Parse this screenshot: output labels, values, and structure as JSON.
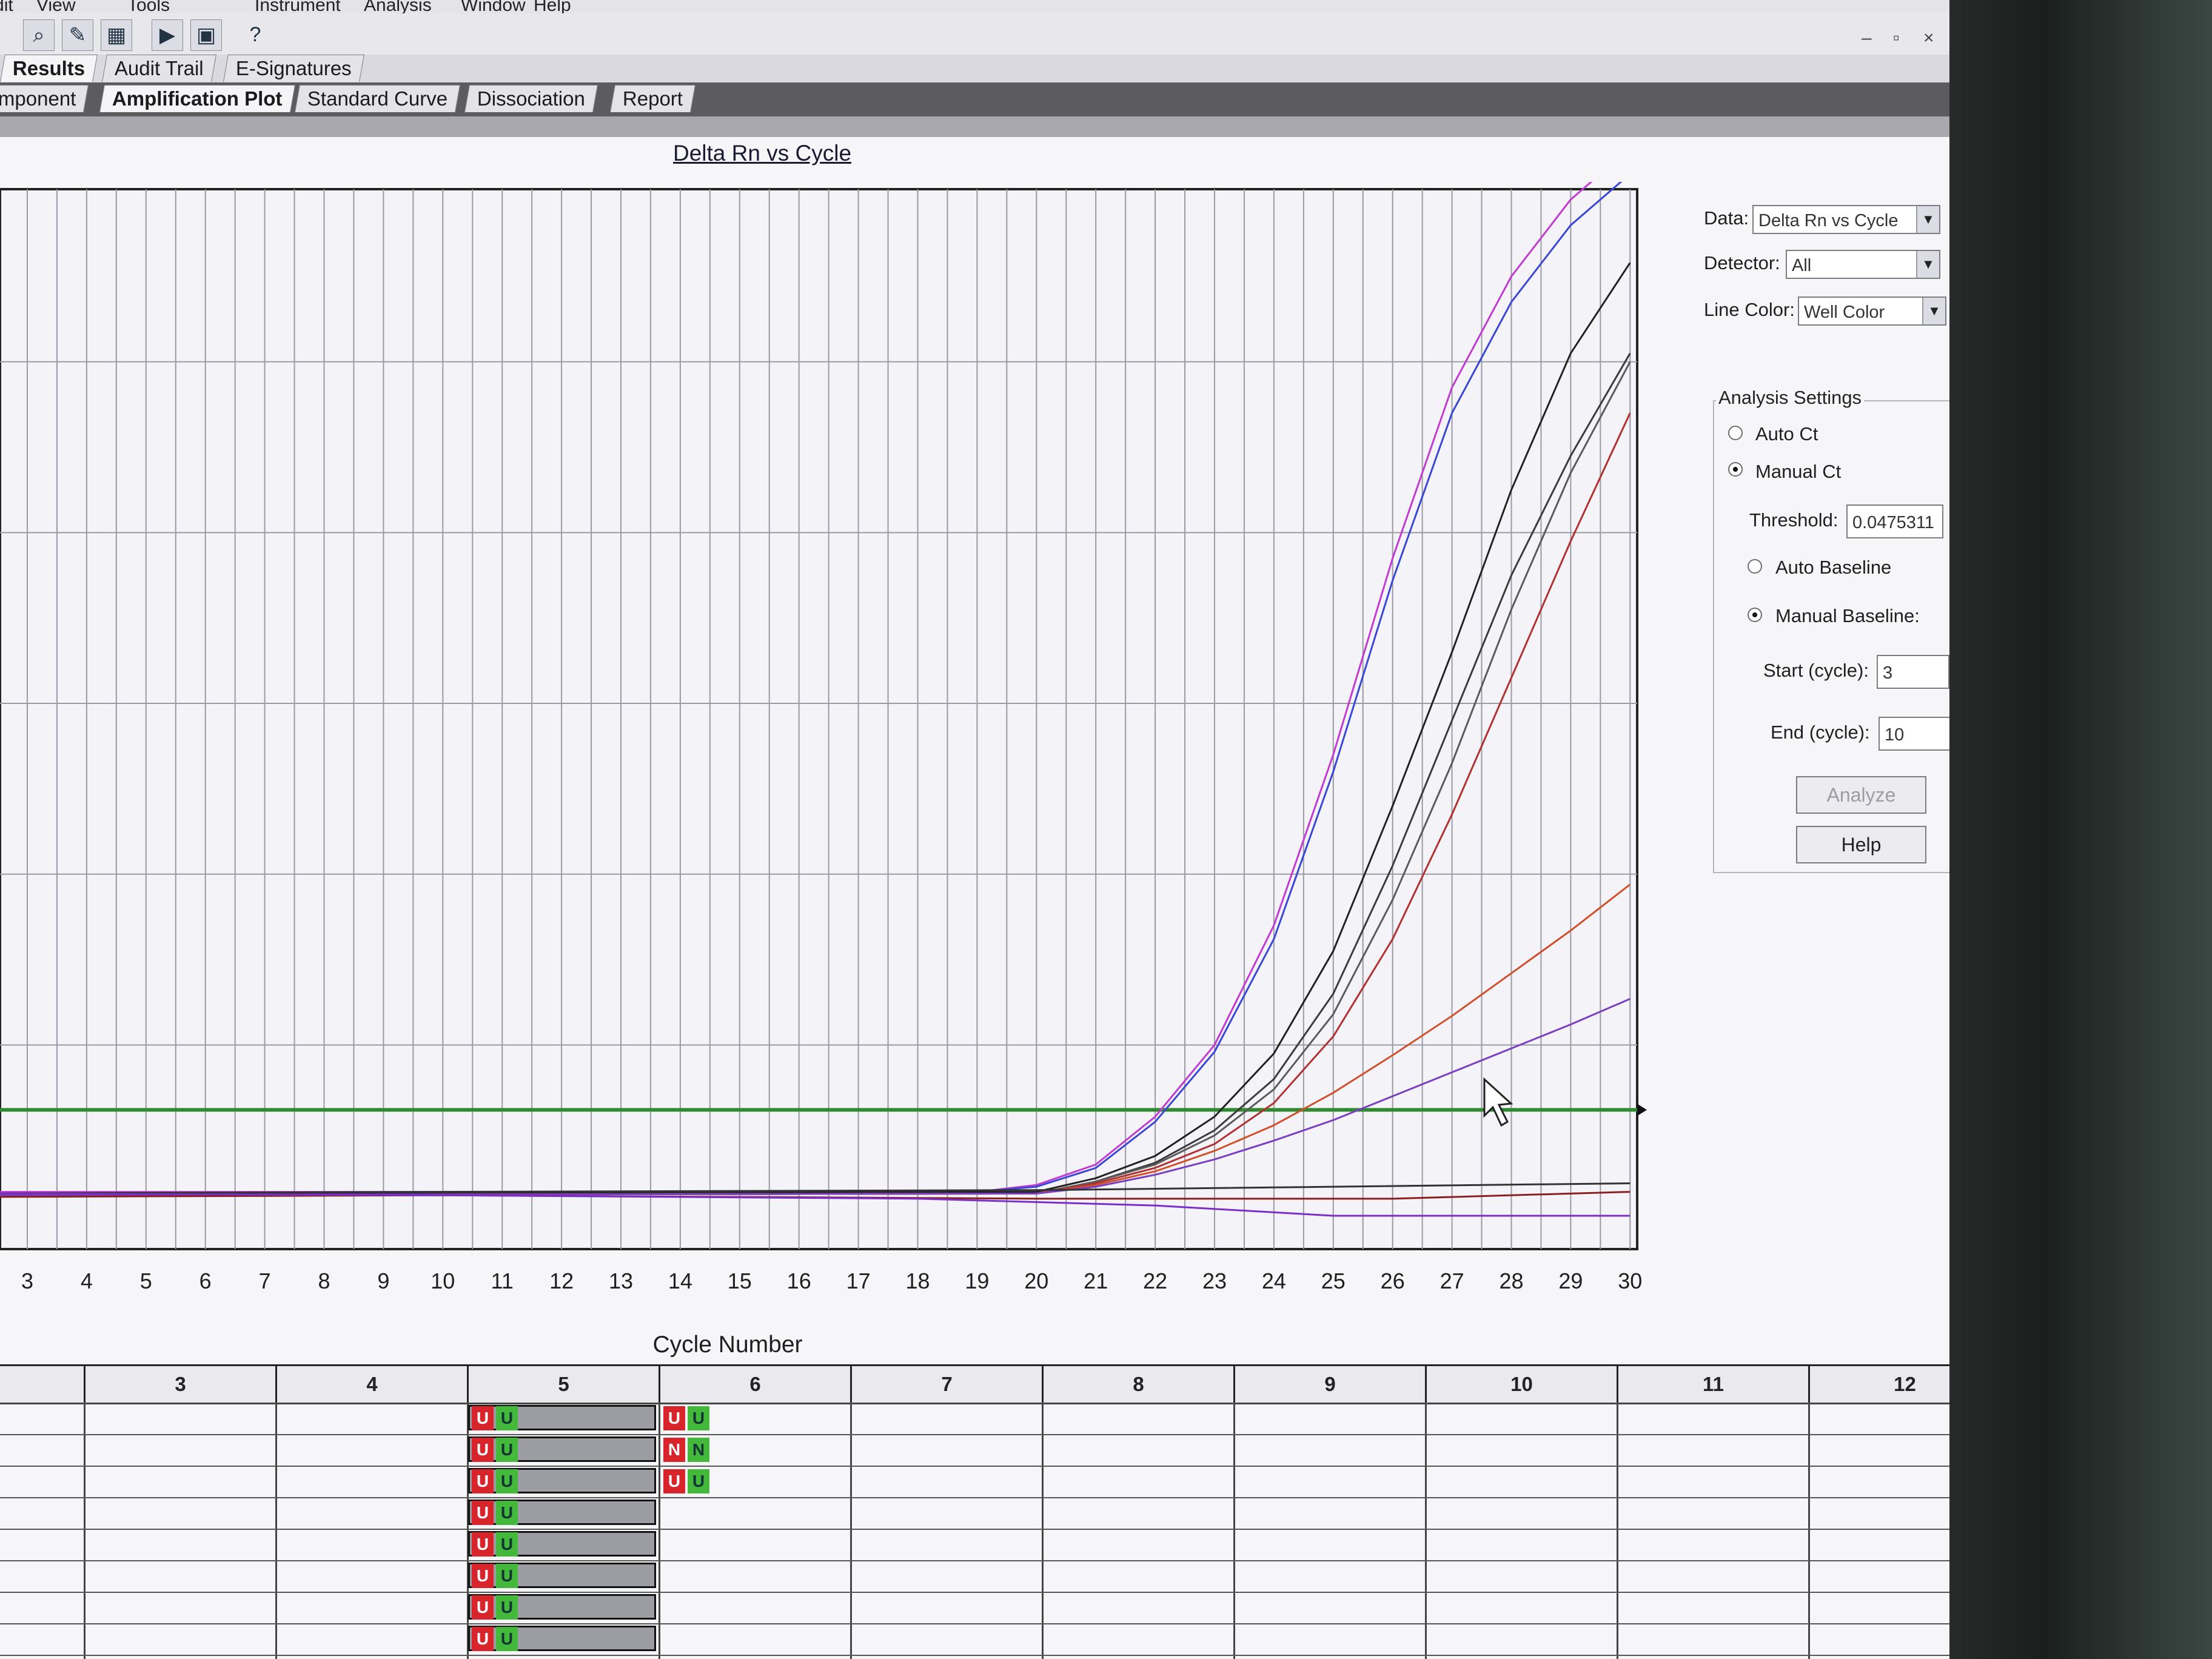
{
  "menu": [
    "Edit",
    "View",
    "Tools",
    "Instrument",
    "Analysis",
    "Window",
    "Help"
  ],
  "window_controls": {
    "minimize": "–",
    "restore": "▫",
    "close": "×"
  },
  "results_tabs": [
    "Results",
    "Audit Trail",
    "E-Signatures"
  ],
  "view_tabs": [
    "mponent",
    "Amplification Plot",
    "Standard Curve",
    "Dissociation",
    "Report"
  ],
  "active_view_tab": "Amplification Plot",
  "chart_data": {
    "type": "line",
    "title": "Delta Rn vs Cycle",
    "xlabel": "Cycle Number",
    "ylabel": "",
    "x_ticks": [
      3,
      4,
      5,
      6,
      7,
      8,
      9,
      10,
      11,
      12,
      13,
      14,
      15,
      16,
      17,
      18,
      19,
      20,
      21,
      22,
      23,
      24,
      25,
      26,
      27,
      28,
      29,
      30
    ],
    "xlim": [
      2.5,
      30.5
    ],
    "ylim": [
      0,
      6
    ],
    "grid": true,
    "threshold": {
      "value": 0.62,
      "color": "#2f8a2f"
    },
    "series": [
      {
        "color": "#c23bd1",
        "x": [
          2,
          19,
          20,
          21,
          22,
          23,
          24,
          25,
          26,
          27,
          28,
          29,
          30
        ],
        "values": [
          0.14,
          0.14,
          0.18,
          0.3,
          0.58,
          1.0,
          1.7,
          2.7,
          3.85,
          4.85,
          5.5,
          5.95,
          6.25
        ]
      },
      {
        "color": "#3a46d6",
        "x": [
          2,
          19,
          20,
          21,
          22,
          23,
          24,
          25,
          26,
          27,
          28,
          29,
          30
        ],
        "values": [
          0.13,
          0.14,
          0.17,
          0.28,
          0.55,
          0.96,
          1.62,
          2.6,
          3.72,
          4.7,
          5.35,
          5.8,
          6.1
        ]
      },
      {
        "color": "#222222",
        "x": [
          2,
          20,
          21,
          22,
          23,
          24,
          25,
          26,
          27,
          28,
          29,
          30
        ],
        "values": [
          0.12,
          0.14,
          0.22,
          0.35,
          0.58,
          0.95,
          1.55,
          2.4,
          3.3,
          4.25,
          5.05,
          5.58
        ]
      },
      {
        "color": "#3b3b3b",
        "x": [
          2,
          20,
          21,
          22,
          23,
          24,
          25,
          26,
          27,
          28,
          29,
          30
        ],
        "values": [
          0.12,
          0.13,
          0.2,
          0.31,
          0.5,
          0.8,
          1.3,
          2.05,
          2.9,
          3.75,
          4.45,
          5.05
        ]
      },
      {
        "color": "#5a5a5a",
        "x": [
          2,
          20,
          21,
          22,
          23,
          24,
          25,
          26,
          27,
          28,
          29,
          30
        ],
        "values": [
          0.12,
          0.13,
          0.2,
          0.3,
          0.47,
          0.74,
          1.18,
          1.85,
          2.65,
          3.55,
          4.35,
          5.0
        ]
      },
      {
        "color": "#b23030",
        "x": [
          2,
          20,
          21,
          22,
          23,
          24,
          25,
          26,
          27,
          28,
          29,
          30
        ],
        "values": [
          0.12,
          0.13,
          0.19,
          0.28,
          0.42,
          0.66,
          1.05,
          1.62,
          2.35,
          3.15,
          3.95,
          4.7
        ]
      },
      {
        "color": "#d0502c",
        "x": [
          2,
          20,
          21,
          22,
          23,
          24,
          25,
          26,
          27,
          28,
          29,
          30
        ],
        "values": [
          0.12,
          0.13,
          0.18,
          0.26,
          0.38,
          0.53,
          0.72,
          0.94,
          1.17,
          1.42,
          1.67,
          1.94
        ]
      },
      {
        "color": "#7a3fc0",
        "x": [
          2,
          20,
          21,
          22,
          23,
          24,
          25,
          26,
          27,
          28,
          29,
          30
        ],
        "values": [
          0.12,
          0.13,
          0.17,
          0.24,
          0.33,
          0.44,
          0.56,
          0.7,
          0.84,
          0.98,
          1.12,
          1.27
        ]
      },
      {
        "color": "#333333",
        "x": [
          2,
          10,
          20,
          30
        ],
        "values": [
          0.13,
          0.14,
          0.15,
          0.19
        ]
      },
      {
        "color": "#8a1f1f",
        "x": [
          2,
          10,
          20,
          26,
          30
        ],
        "values": [
          0.11,
          0.12,
          0.1,
          0.1,
          0.14
        ]
      },
      {
        "color": "#7b2fc9",
        "x": [
          2,
          10,
          18,
          22,
          25,
          30
        ],
        "values": [
          0.13,
          0.12,
          0.1,
          0.06,
          0.0,
          0.0
        ]
      }
    ]
  },
  "right_panel": {
    "data_label": "Data:",
    "data_value": "Delta Rn vs Cycle",
    "detector_label": "Detector:",
    "detector_value": "All",
    "line_color_label": "Line Color:",
    "line_color_value": "Well Color",
    "group_title": "Analysis Settings",
    "auto_ct": "Auto Ct",
    "manual_ct": "Manual Ct",
    "threshold_label": "Threshold:",
    "threshold_value": "0.0475311",
    "auto_baseline": "Auto Baseline",
    "manual_baseline": "Manual Baseline:",
    "start_label": "Start (cycle):",
    "start_value": "3",
    "end_label": "End (cycle):",
    "end_value": "10",
    "analyze_button": "Analyze",
    "help_button": "Help"
  },
  "plate": {
    "columns": [
      "3",
      "4",
      "5",
      "6",
      "7",
      "8",
      "9",
      "10",
      "11",
      "12"
    ],
    "col5_tags": [
      [
        "U",
        "U"
      ],
      [
        "U",
        "U"
      ],
      [
        "U",
        "U"
      ],
      [
        "U",
        "U"
      ],
      [
        "U",
        "U"
      ],
      [
        "U",
        "U"
      ],
      [
        "U",
        "U"
      ],
      [
        "U",
        "U"
      ]
    ],
    "col6_tags": [
      [
        "U",
        "U"
      ],
      [
        "N",
        "N"
      ],
      [
        "U",
        "U"
      ]
    ]
  }
}
